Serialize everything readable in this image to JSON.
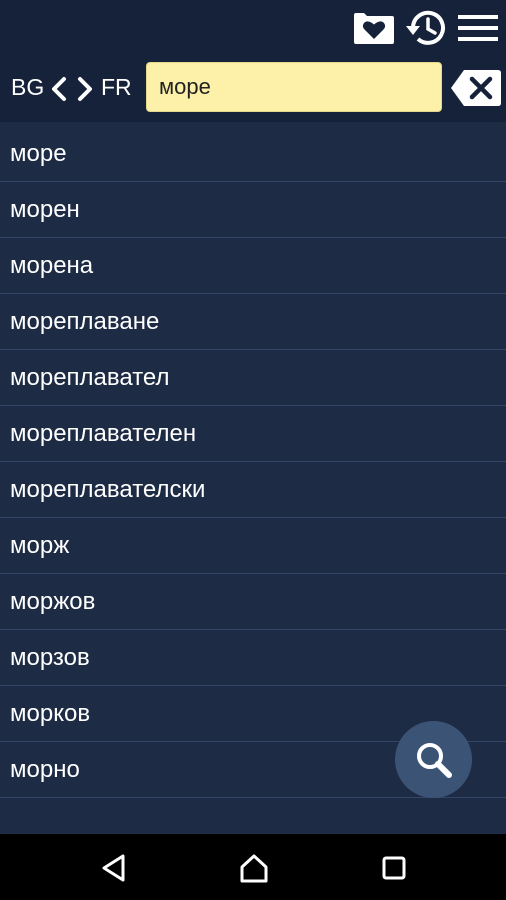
{
  "header": {
    "icons": [
      "favorites-heart-icon",
      "history-icon",
      "menu-icon"
    ]
  },
  "language": {
    "source": "BG",
    "target": "FR"
  },
  "search": {
    "value": "море",
    "placeholder": ""
  },
  "results": [
    "море",
    "морен",
    "морена",
    "мореплаване",
    "мореплавател",
    "мореплавателен",
    "мореплавателски",
    "морж",
    "моржов",
    "морзов",
    "морков",
    "морно"
  ],
  "colors": {
    "background": "#1d2b45",
    "topbar": "#15223a",
    "search_bg": "#fdf0a9",
    "divider": "#34456a",
    "fab": "#3b5476"
  }
}
